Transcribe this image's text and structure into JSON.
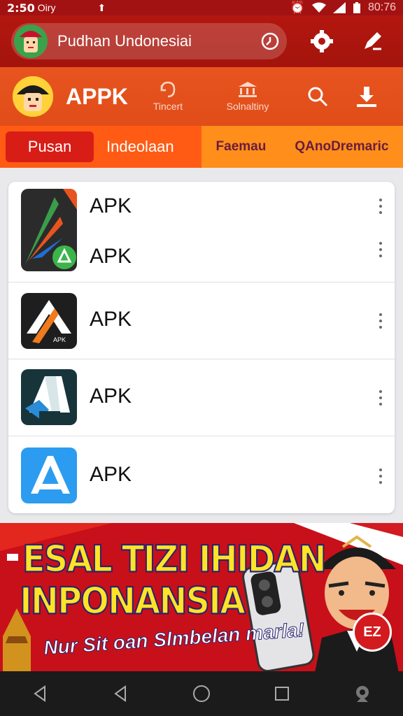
{
  "status_bar": {
    "time": "2:50",
    "carrier": "Oiry",
    "clock_right": "80:76"
  },
  "top_bar": {
    "search_text": "Pudhan Undonesiai"
  },
  "app_bar": {
    "title": "APPK",
    "nav": [
      {
        "label": "Tincert"
      },
      {
        "label": "Solnaltiny"
      }
    ]
  },
  "tabs": {
    "active": "Pusan",
    "second": "Indeolaan",
    "third": "Faemau",
    "fourth": "QAnoDremaric"
  },
  "apps": [
    {
      "label_a": "APK",
      "label_b": "APK"
    },
    {
      "label": "APK",
      "icon_caption": "APK"
    },
    {
      "label": "APK"
    },
    {
      "label": "APK"
    }
  ],
  "banner": {
    "line1": "ESAL TIZI IHIDAN",
    "line2": "INPONANSIA",
    "line3": "Nur Sit oan Slmbelan marla!",
    "badge": "EZ"
  },
  "colors": {
    "primary": "#b3170f",
    "accent": "#e8541f",
    "tab_active": "#d81d16"
  }
}
